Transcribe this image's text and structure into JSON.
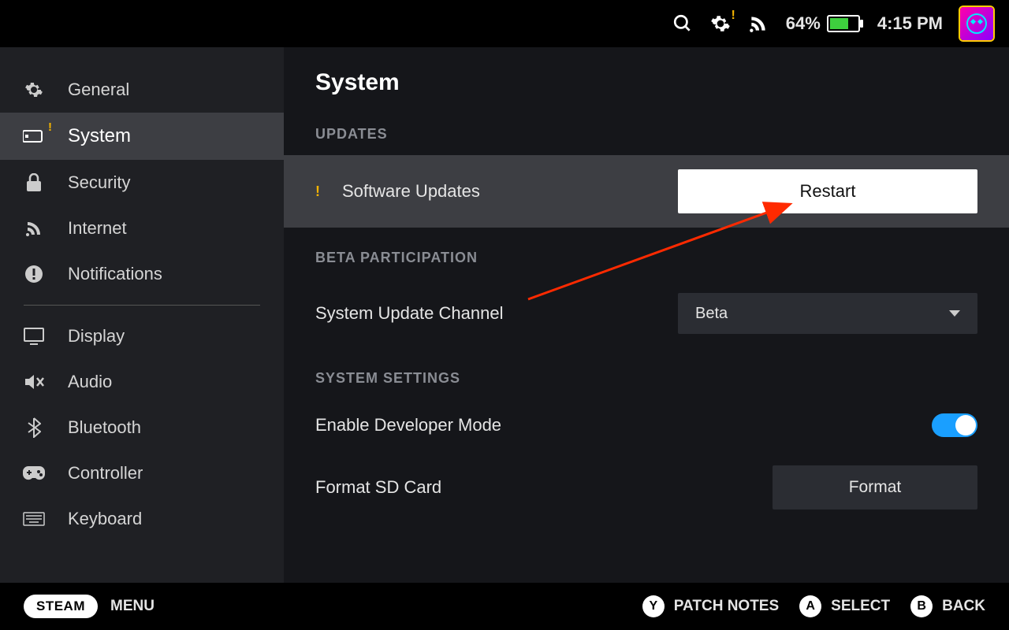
{
  "topbar": {
    "battery_percent": "64%",
    "time": "4:15 PM"
  },
  "sidebar": {
    "items": [
      {
        "label": "General"
      },
      {
        "label": "System"
      },
      {
        "label": "Security"
      },
      {
        "label": "Internet"
      },
      {
        "label": "Notifications"
      },
      {
        "label": "Display"
      },
      {
        "label": "Audio"
      },
      {
        "label": "Bluetooth"
      },
      {
        "label": "Controller"
      },
      {
        "label": "Keyboard"
      }
    ]
  },
  "main": {
    "title": "System",
    "sections": {
      "updates": {
        "header": "UPDATES",
        "software_updates_label": "Software Updates",
        "restart_label": "Restart"
      },
      "beta": {
        "header": "BETA PARTICIPATION",
        "channel_label": "System Update Channel",
        "channel_value": "Beta"
      },
      "system_settings": {
        "header": "SYSTEM SETTINGS",
        "dev_mode_label": "Enable Developer Mode",
        "format_label": "Format SD Card",
        "format_button": "Format"
      }
    }
  },
  "bottombar": {
    "steam": "STEAM",
    "menu": "MENU",
    "y_label": "PATCH NOTES",
    "a_label": "SELECT",
    "b_label": "BACK"
  }
}
